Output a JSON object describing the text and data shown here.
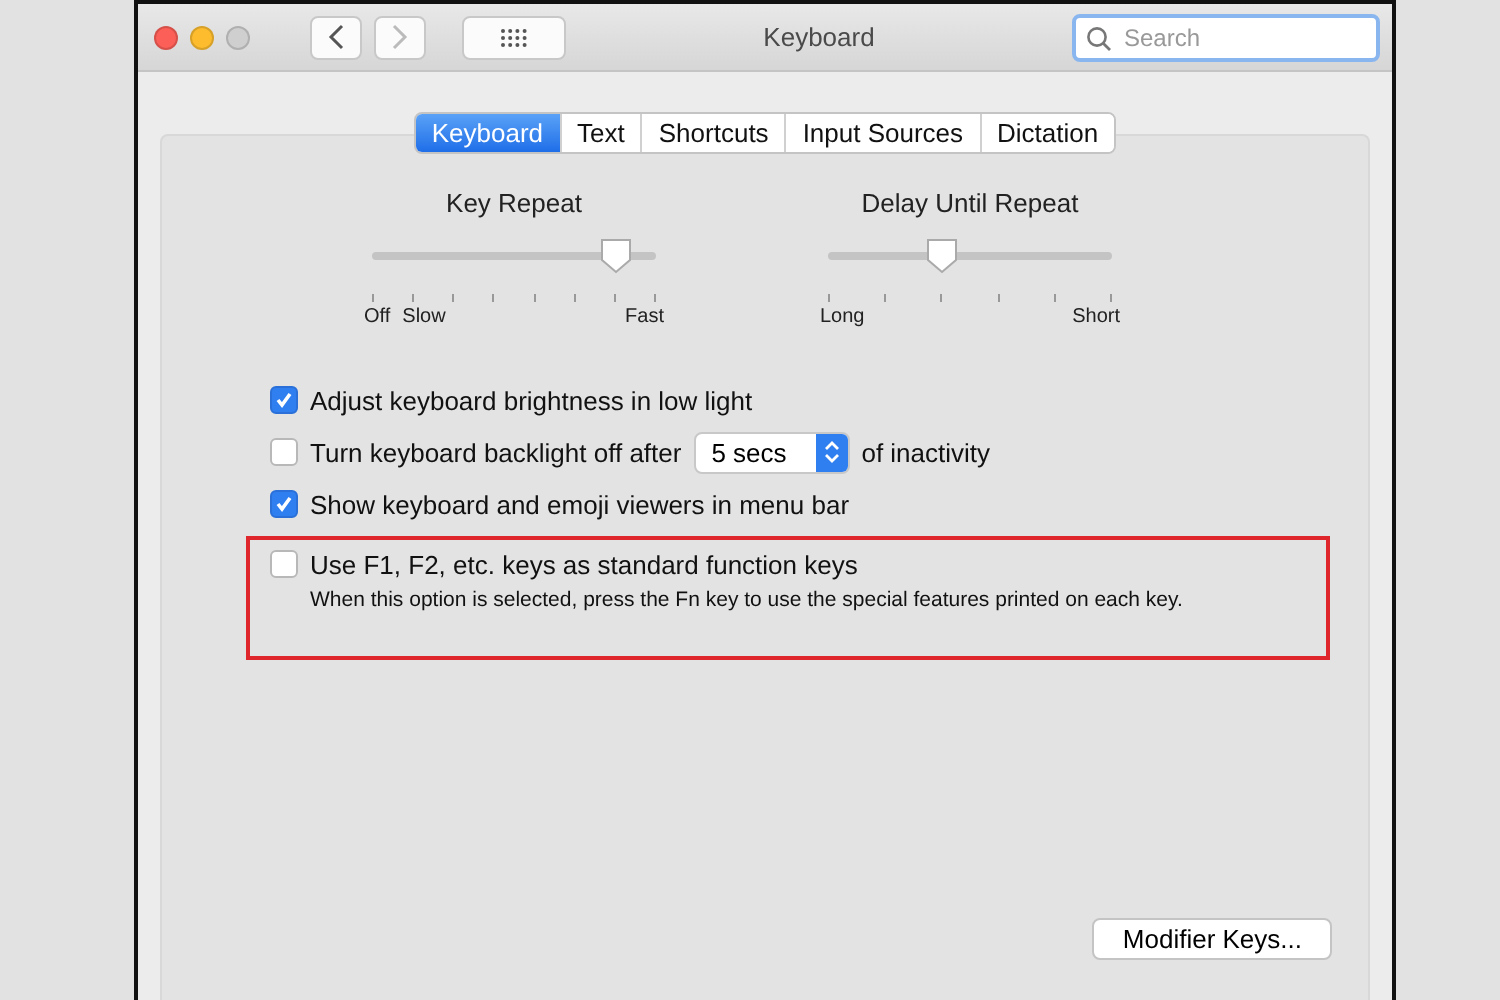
{
  "window": {
    "title": "Keyboard"
  },
  "search": {
    "placeholder": "Search"
  },
  "tabs": [
    {
      "label": "Keyboard",
      "selected": true
    },
    {
      "label": "Text",
      "selected": false
    },
    {
      "label": "Shortcuts",
      "selected": false
    },
    {
      "label": "Input Sources",
      "selected": false
    },
    {
      "label": "Dictation",
      "selected": false
    }
  ],
  "sliders": [
    {
      "title": "Key Repeat",
      "level": 0.86,
      "labels": [
        "Off",
        "Slow",
        "Fast"
      ]
    },
    {
      "title": "Delay Until Repeat",
      "level": 0.4,
      "labels": [
        "Long",
        "Short"
      ]
    }
  ],
  "options": [
    {
      "kind": "check",
      "label": "Adjust keyboard brightness in low light",
      "checked": true
    },
    {
      "kind": "select",
      "label": "Turn keyboard backlight off after",
      "checked": false,
      "value": "5 secs",
      "suffix": "of inactivity"
    },
    {
      "kind": "check",
      "label": "Show keyboard and emoji viewers in menu bar",
      "checked": true
    },
    {
      "kind": "check",
      "label": "Use F1, F2, etc. keys as standard function keys",
      "checked": false,
      "note": "When this option is selected, press the Fn key to use the special features printed on each key.",
      "highlighted": true
    }
  ],
  "buttons": [
    "Modifier Keys..."
  ]
}
